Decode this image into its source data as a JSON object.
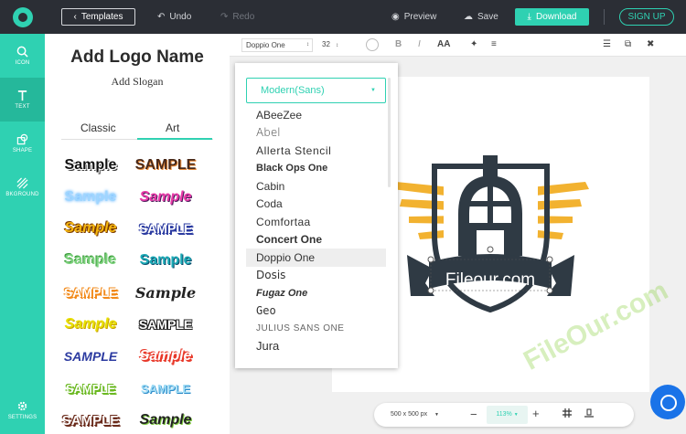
{
  "topbar": {
    "templates_label": "Templates",
    "undo_label": "Undo",
    "redo_label": "Redo",
    "preview_label": "Preview",
    "save_label": "Save",
    "download_label": "Download",
    "signup_label": "SIGN UP"
  },
  "rail": {
    "items": [
      {
        "label": "ICON",
        "icon": "search-icon"
      },
      {
        "label": "TEXT",
        "icon": "text-icon"
      },
      {
        "label": "SHAPE",
        "icon": "shape-icon"
      },
      {
        "label": "BKGROUND",
        "icon": "background-icon"
      },
      {
        "label": "SETTINGS",
        "icon": "gear-icon"
      }
    ]
  },
  "panel": {
    "title": "Add Logo Name",
    "slogan": "Add Slogan",
    "tabs": [
      {
        "label": "Classic"
      },
      {
        "label": "Art"
      }
    ],
    "samples": [
      {
        "text": "Sample"
      },
      {
        "text": "SAMPLE"
      },
      {
        "text": "Sample"
      },
      {
        "text": "Sample"
      },
      {
        "text": "Sample"
      },
      {
        "text": "SAMPLE"
      },
      {
        "text": "Sample"
      },
      {
        "text": "Sample"
      },
      {
        "text": "SAMPLE"
      },
      {
        "text": "Sample"
      },
      {
        "text": "Sample"
      },
      {
        "text": "SAMPLE"
      },
      {
        "text": "SAMPLE"
      },
      {
        "text": "Sample"
      },
      {
        "text": "SAMPLE"
      },
      {
        "text": "SAMPLE"
      },
      {
        "text": "SAMPLE"
      },
      {
        "text": "Sample"
      }
    ]
  },
  "format": {
    "font": "Doppio One",
    "size": "32"
  },
  "dropdown": {
    "selected_category": "Modern(Sans)",
    "fonts": [
      {
        "name": "ABeeZee"
      },
      {
        "name": "Abel"
      },
      {
        "name": "Allerta Stencil"
      },
      {
        "name": "Black Ops One"
      },
      {
        "name": "Cabin"
      },
      {
        "name": "Coda"
      },
      {
        "name": "Comfortaa"
      },
      {
        "name": "Concert One"
      },
      {
        "name": "Doppio One"
      },
      {
        "name": "Dosis"
      },
      {
        "name": "Fugaz One"
      },
      {
        "name": "Geo"
      },
      {
        "name": "JULIUS SANS ONE"
      },
      {
        "name": "Jura"
      }
    ]
  },
  "canvas": {
    "logo_text": "Fileour.com"
  },
  "watermark": "FileOur.com",
  "bottombar": {
    "size": "500 x 500 px",
    "zoom": "113%"
  },
  "colors": {
    "accent": "#2fd1b2",
    "topbar": "#2b2e35",
    "logo_gold": "#f2b230",
    "logo_dark": "#2f3a44"
  }
}
